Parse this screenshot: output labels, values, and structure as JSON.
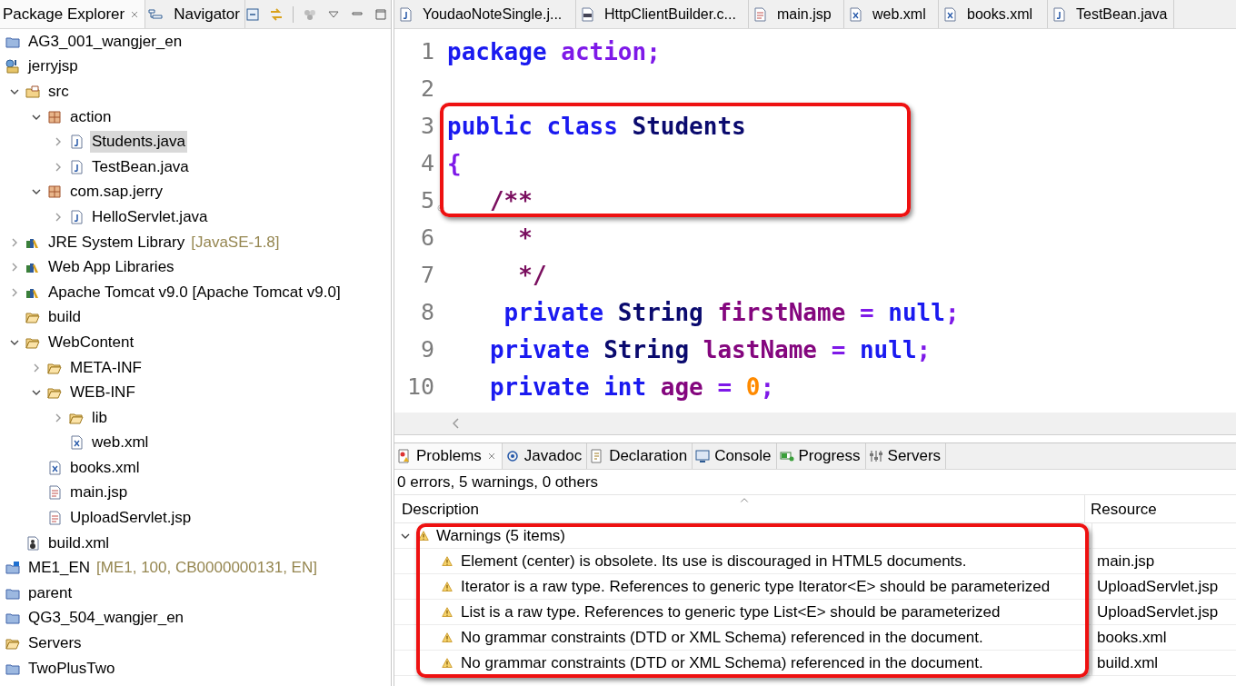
{
  "explorer": {
    "tabs": [
      {
        "label": "Package Explorer",
        "selected": true
      },
      {
        "label": "Navigator",
        "selected": false
      }
    ],
    "tree": [
      {
        "label": "AG3_001_wangjer_en",
        "kind": "project",
        "selected": false
      },
      {
        "label": "jerryjsp",
        "kind": "web-project",
        "selected": false,
        "children": [
          {
            "label": "src",
            "kind": "source-folder",
            "selected": false,
            "expanded": true,
            "children": [
              {
                "label": "action",
                "kind": "package",
                "selected": false,
                "expanded": true,
                "children": [
                  {
                    "label": "Students.java",
                    "kind": "java-file",
                    "selected": true,
                    "expanded": false
                  },
                  {
                    "label": "TestBean.java",
                    "kind": "java-file",
                    "selected": false,
                    "expanded": false
                  }
                ]
              },
              {
                "label": "com.sap.jerry",
                "kind": "package",
                "selected": false,
                "expanded": true,
                "children": [
                  {
                    "label": "HelloServlet.java",
                    "kind": "java-file",
                    "selected": false,
                    "expanded": false
                  }
                ]
              }
            ]
          },
          {
            "label": "JRE System Library",
            "decoration": "[JavaSE-1.8]",
            "kind": "library",
            "selected": false,
            "expanded": false
          },
          {
            "label": "Web App Libraries",
            "kind": "library",
            "selected": false,
            "expanded": false
          },
          {
            "label": "Apache Tomcat v9.0 [Apache Tomcat v9.0]",
            "kind": "library",
            "selected": false,
            "expanded": false
          },
          {
            "label": "build",
            "kind": "folder",
            "selected": false
          },
          {
            "label": "WebContent",
            "kind": "folder",
            "selected": false,
            "expanded": true,
            "children": [
              {
                "label": "META-INF",
                "kind": "folder",
                "selected": false,
                "expanded": false
              },
              {
                "label": "WEB-INF",
                "kind": "folder",
                "selected": false,
                "expanded": true,
                "children": [
                  {
                    "label": "lib",
                    "kind": "folder",
                    "selected": false,
                    "expanded": false
                  },
                  {
                    "label": "web.xml",
                    "kind": "xml-file",
                    "selected": false
                  }
                ]
              },
              {
                "label": "books.xml",
                "kind": "xml-file",
                "selected": false
              },
              {
                "label": "main.jsp",
                "kind": "jsp-file",
                "selected": false
              },
              {
                "label": "UploadServlet.jsp",
                "kind": "jsp-file",
                "selected": false
              }
            ]
          },
          {
            "label": "build.xml",
            "kind": "ant-file",
            "selected": false
          }
        ]
      },
      {
        "label": "ME1_EN",
        "decoration": "[ME1, 100, CB0000000131, EN]",
        "kind": "sap-project",
        "selected": false
      },
      {
        "label": "parent",
        "kind": "project",
        "selected": false
      },
      {
        "label": "QG3_504_wangjer_en",
        "kind": "project",
        "selected": false
      },
      {
        "label": "Servers",
        "kind": "folder",
        "selected": false
      },
      {
        "label": "TwoPlusTwo",
        "kind": "project",
        "selected": false
      }
    ]
  },
  "editor": {
    "highlight_frame": true,
    "tabs": [
      {
        "label": "YoudaoNoteSingle.j...",
        "kind": "java-file"
      },
      {
        "label": "HttpClientBuilder.c...",
        "kind": "binary-file"
      },
      {
        "label": "main.jsp",
        "kind": "jsp-file"
      },
      {
        "label": "web.xml",
        "kind": "xml-file"
      },
      {
        "label": "books.xml",
        "kind": "xml-file"
      },
      {
        "label": "TestBean.java",
        "kind": "java-file"
      }
    ],
    "lines": [
      {
        "number": "1",
        "foldable": false,
        "tokens": [
          {
            "text": "package ",
            "kind": "keyword"
          },
          {
            "text": "action;",
            "kind": "punct"
          }
        ]
      },
      {
        "number": "2",
        "foldable": false
      },
      {
        "number": "3",
        "foldable": false,
        "tokens": [
          {
            "text": "public class ",
            "kind": "keyword"
          },
          {
            "text": "Students",
            "kind": "type"
          }
        ]
      },
      {
        "number": "4",
        "foldable": false,
        "tokens": [
          {
            "text": "{",
            "kind": "punct"
          }
        ]
      },
      {
        "number": "5",
        "foldable": true,
        "tokens": [
          {
            "text": "   /**",
            "kind": "comment"
          }
        ]
      },
      {
        "number": "6",
        "foldable": false,
        "tokens": [
          {
            "text": "     *",
            "kind": "comment"
          }
        ]
      },
      {
        "number": "7",
        "foldable": false,
        "tokens": [
          {
            "text": "     */",
            "kind": "comment"
          }
        ]
      },
      {
        "number": "8",
        "foldable": false,
        "tokens": [
          {
            "text": "    private ",
            "kind": "keyword"
          },
          {
            "text": "String ",
            "kind": "type"
          },
          {
            "text": "firstName ",
            "kind": "field"
          },
          {
            "text": "= ",
            "kind": "punct"
          },
          {
            "text": "null",
            "kind": "keyword"
          },
          {
            "text": ";",
            "kind": "punct"
          }
        ]
      },
      {
        "number": "9",
        "foldable": false,
        "tokens": [
          {
            "text": "   private ",
            "kind": "keyword"
          },
          {
            "text": "String ",
            "kind": "type"
          },
          {
            "text": "lastName ",
            "kind": "field"
          },
          {
            "text": "= ",
            "kind": "punct"
          },
          {
            "text": "null",
            "kind": "keyword"
          },
          {
            "text": ";",
            "kind": "punct"
          }
        ]
      },
      {
        "number": "10",
        "foldable": false,
        "tokens": [
          {
            "text": "   private int ",
            "kind": "keyword"
          },
          {
            "text": "age ",
            "kind": "field"
          },
          {
            "text": "= ",
            "kind": "punct"
          },
          {
            "text": "0",
            "kind": "number"
          },
          {
            "text": ";",
            "kind": "punct"
          }
        ]
      }
    ]
  },
  "bottom_panel": {
    "highlight_frame": true,
    "tabs": [
      {
        "label": "Problems",
        "kind": "problems",
        "selected": true
      },
      {
        "label": "Javadoc",
        "kind": "javadoc",
        "selected": false
      },
      {
        "label": "Declaration",
        "kind": "declaration",
        "selected": false
      },
      {
        "label": "Console",
        "kind": "console",
        "selected": false
      },
      {
        "label": "Progress",
        "kind": "progress",
        "selected": false
      },
      {
        "label": "Servers",
        "kind": "servers",
        "selected": false
      }
    ],
    "summary": "0 errors, 5 warnings, 0 others",
    "columns": [
      "Description",
      "Resource"
    ],
    "groups": [
      {
        "label": "Warnings (5 items)",
        "expanded": true,
        "rows": [
          {
            "description": "Element (center) is obsolete. Its use is discouraged in HTML5 documents.",
            "resource": "main.jsp"
          },
          {
            "description": "Iterator is a raw type. References to generic type Iterator<E> should be parameterized",
            "resource": "UploadServlet.jsp"
          },
          {
            "description": "List is a raw type. References to generic type List<E> should be parameterized",
            "resource": "UploadServlet.jsp"
          },
          {
            "description": "No grammar constraints (DTD or XML Schema) referenced in the document.",
            "resource": "books.xml"
          },
          {
            "description": "No grammar constraints (DTD or XML Schema) referenced in the document.",
            "resource": "build.xml"
          }
        ]
      }
    ]
  }
}
